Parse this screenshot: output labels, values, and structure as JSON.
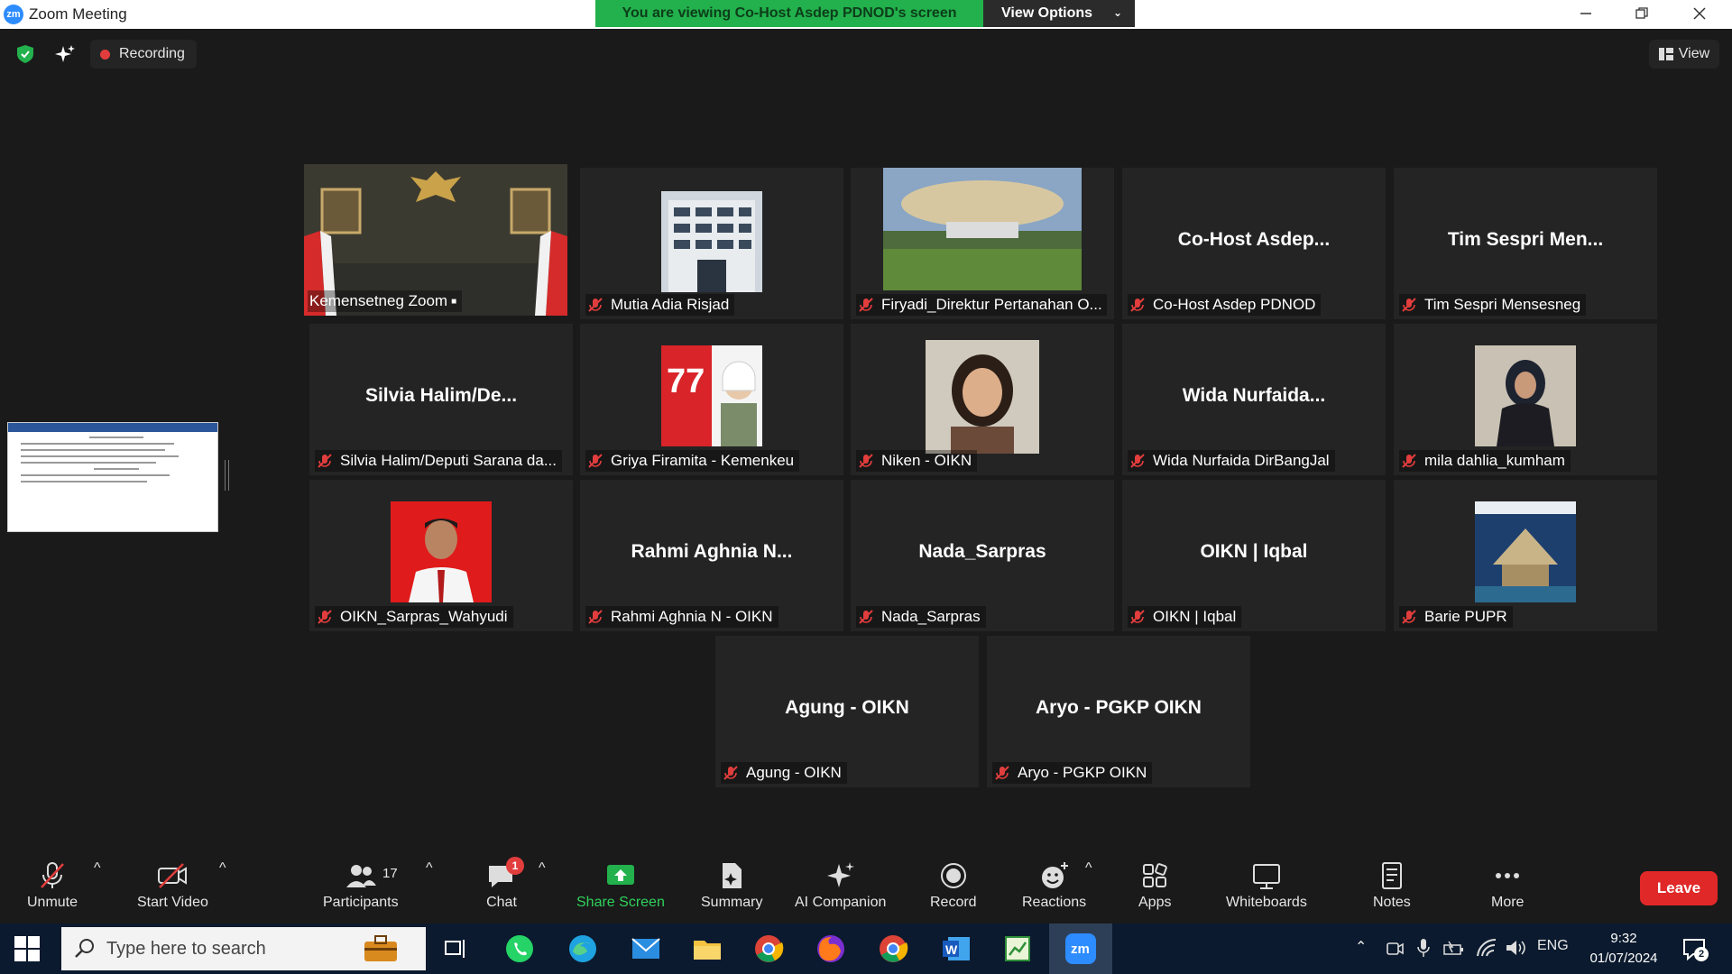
{
  "window": {
    "app_logo": "zm",
    "title": "Zoom Meeting",
    "banner": "You are viewing Co-Host Asdep PDNOD's screen",
    "view_options": "View Options",
    "controls": [
      "minimize-icon",
      "restore-icon",
      "close-icon"
    ]
  },
  "topbar": {
    "recording": "Recording",
    "view": "View"
  },
  "tiles": [
    {
      "display": "",
      "tag": "Kemensetneg Zoom",
      "image": "room-backdrop",
      "active": true
    },
    {
      "display": "",
      "tag": "Mutia Adia Risjad",
      "image": "building"
    },
    {
      "display": "",
      "tag": "Firyadi_Direktur Pertanahan O...",
      "image": "landscape"
    },
    {
      "display": "Co-Host  Asdep...",
      "tag": "Co-Host Asdep PDNOD"
    },
    {
      "display": "Tim  Sespri  Men...",
      "tag": "Tim Sespri Mensesneg"
    },
    {
      "display": "Silvia  Halim/De...",
      "tag": "Silvia Halim/Deputi Sarana da..."
    },
    {
      "display": "",
      "tag": "Griya Firamita - Kemenkeu",
      "image": "poster-77"
    },
    {
      "display": "",
      "tag": "Niken - OIKN",
      "image": "portrait-woman"
    },
    {
      "display": "Wida  Nurfaida...",
      "tag": "Wida Nurfaida DirBangJal"
    },
    {
      "display": "",
      "tag": "mila dahlia_kumham",
      "image": "portrait-hijab"
    },
    {
      "display": "",
      "tag": "OIKN_Sarpras_Wahyudi",
      "image": "portrait-red"
    },
    {
      "display": "Rahmi  Aghnia  N...",
      "tag": "Rahmi Aghnia N - OIKN"
    },
    {
      "display": "Nada_Sarpras",
      "tag": "Nada_Sarpras"
    },
    {
      "display": "OIKN | Iqbal",
      "tag": "OIKN | Iqbal"
    },
    {
      "display": "",
      "tag": "Barie PUPR",
      "image": "poster-building"
    },
    {
      "display": "Agung - OIKN",
      "tag": "Agung - OIKN"
    },
    {
      "display": "Aryo - PGKP OIKN",
      "tag": "Aryo - PGKP OIKN"
    }
  ],
  "toolbar": {
    "unmute": "Unmute",
    "start_video": "Start Video",
    "participants": "Participants",
    "participants_count": "17",
    "chat": "Chat",
    "chat_badge": "1",
    "share_screen": "Share Screen",
    "summary": "Summary",
    "ai_companion": "AI Companion",
    "record": "Record",
    "reactions": "Reactions",
    "apps": "Apps",
    "whiteboards": "Whiteboards",
    "notes": "Notes",
    "more": "More",
    "leave": "Leave"
  },
  "taskbar": {
    "search_placeholder": "Type here to search",
    "lang": "ENG",
    "time": "9:32",
    "date": "01/07/2024",
    "notification_count": "2",
    "apps": [
      "task-view",
      "whatsapp",
      "edge",
      "mail",
      "file-explorer",
      "chrome",
      "firefox",
      "chrome-profile",
      "word",
      "sheet",
      "zoom"
    ]
  },
  "colors": {
    "banner_green": "#22b14c",
    "active_speaker": "#c9e26a",
    "leave_red": "#e02828",
    "share_green": "#2fd15b"
  }
}
